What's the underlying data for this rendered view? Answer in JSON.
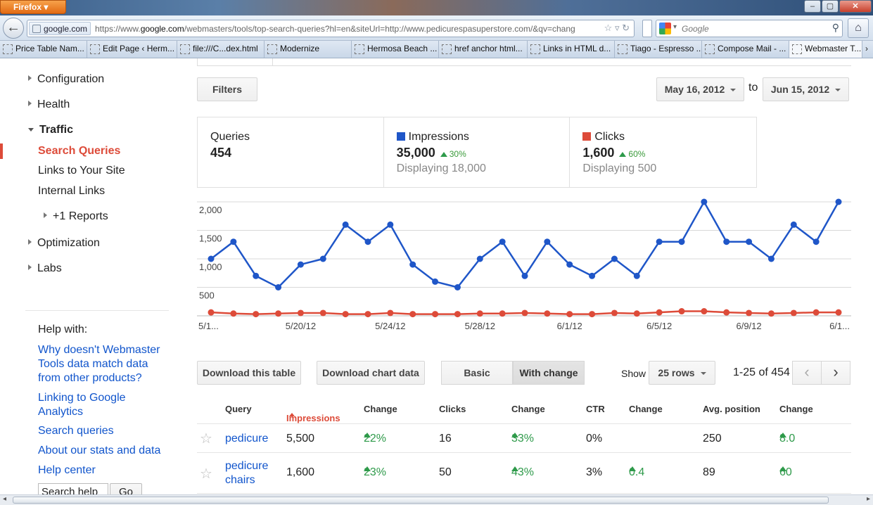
{
  "browser": {
    "menu_label": "Firefox",
    "window_buttons": [
      "‒",
      "▢",
      "✕"
    ],
    "url_site": "google.com",
    "url_prefix": "https://www.",
    "url_host": "google.com",
    "url_rest": "/webmasters/tools/top-search-queries?hl=en&siteUrl=http://www.pedicurespasuperstore.com/&qv=chang",
    "search_placeholder": "Google",
    "bookmarks": [
      "Price Table Nam...",
      "Edit Page ‹ Herm...",
      "file:///C...dex.html",
      "Modernize",
      "Hermosa Beach ...",
      "href anchor html...",
      "Links in HTML d...",
      "Tiago - Espresso ...",
      "Compose Mail - ...",
      "Webmaster T..."
    ],
    "bookmarks_more": "›"
  },
  "sidebar": {
    "configuration": "Configuration",
    "health": "Health",
    "traffic": "Traffic",
    "search_queries": "Search Queries",
    "links_to_site": "Links to Your Site",
    "internal_links": "Internal Links",
    "plus1_reports": "+1 Reports",
    "optimization": "Optimization",
    "labs": "Labs",
    "help_title": "Help with:",
    "help_links": [
      "Why doesn't Webmaster Tools data match data from other products?",
      "Linking to Google Analytics",
      "Search queries",
      "About our stats and data",
      "Help center"
    ],
    "search_help_value": "Search help",
    "go_label": "Go"
  },
  "main": {
    "filters_label": "Filters",
    "date_from": "May 16, 2012",
    "to_label": "to",
    "date_to": "Jun 15, 2012",
    "stats": {
      "queries_label": "Queries",
      "queries_value": "454",
      "impressions_label": "Impressions",
      "impressions_value": "35,000",
      "impressions_change": "30%",
      "impressions_sub": "Displaying 18,000",
      "clicks_label": "Clicks",
      "clicks_value": "1,600",
      "clicks_change": "60%",
      "clicks_sub": "Displaying 500"
    },
    "colors": {
      "impressions": "#1f56c8",
      "clicks": "#dd4b39",
      "up": "#2e9a4a",
      "active": "#dd4b39",
      "link": "#1155cc"
    },
    "download_table": "Download this table",
    "download_chart": "Download chart data",
    "basic_label": "Basic",
    "with_change_label": "With change",
    "show_label": "Show",
    "rows_value": "25 rows",
    "range_label": "1-25 of 454",
    "table": {
      "headers": [
        "Query",
        "Impressions",
        "Change",
        "Clicks",
        "Change",
        "CTR",
        "Change",
        "Avg. position",
        "Change"
      ],
      "rows": [
        {
          "query": "pedicure",
          "impressions": "5,500",
          "imp_change": "22%",
          "clicks": "16",
          "clk_change": "33%",
          "ctr": "0%",
          "ctr_change": "",
          "position": "250",
          "pos_change": "8.0"
        },
        {
          "query": "pedicure chairs",
          "impressions": "1,600",
          "imp_change": "23%",
          "clicks": "50",
          "clk_change": "43%",
          "ctr": "3%",
          "ctr_change": "0.4",
          "position": "89",
          "pos_change": "60"
        }
      ]
    }
  },
  "chart_data": {
    "type": "line",
    "x_tick_labels": [
      "5/1...",
      "5/20/12",
      "5/24/12",
      "5/28/12",
      "6/1/12",
      "6/5/12",
      "6/9/12",
      "6/1..."
    ],
    "y_tick_labels": [
      "2,000",
      "1,500",
      "1,000",
      "500"
    ],
    "ylim": [
      0,
      2000
    ],
    "grid": true,
    "series": [
      {
        "name": "Impressions",
        "color": "#1f56c8",
        "values": [
          1000,
          1300,
          700,
          500,
          900,
          1000,
          1600,
          1300,
          1600,
          900,
          600,
          500,
          1000,
          1300,
          700,
          1300,
          900,
          700,
          1000,
          700,
          1300,
          1300,
          2000,
          1300,
          1300,
          1000,
          1600,
          1300,
          2000
        ]
      },
      {
        "name": "Clicks",
        "color": "#dd4b39",
        "values": [
          60,
          40,
          30,
          40,
          50,
          50,
          30,
          30,
          50,
          30,
          30,
          30,
          40,
          40,
          50,
          40,
          30,
          30,
          50,
          40,
          60,
          80,
          80,
          60,
          50,
          40,
          50,
          60,
          60
        ]
      }
    ]
  }
}
